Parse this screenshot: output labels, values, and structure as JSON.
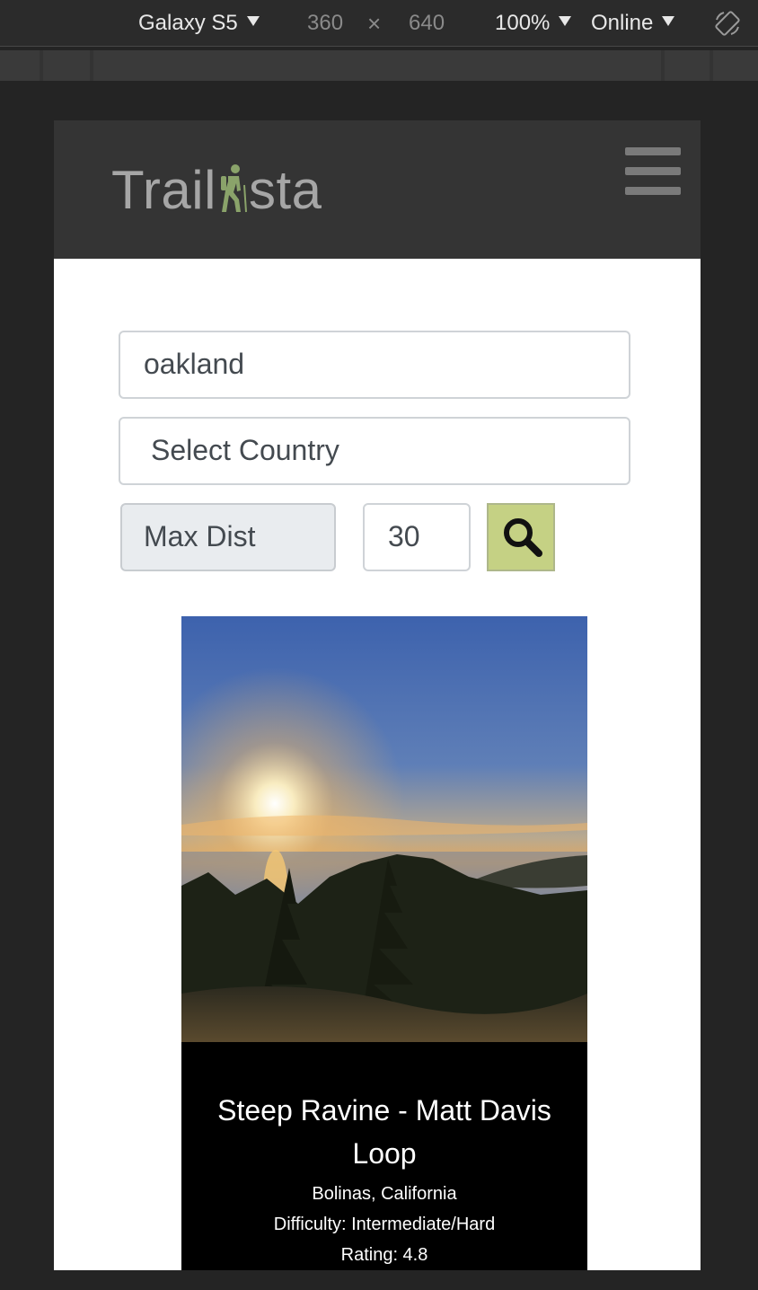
{
  "devtools": {
    "device": "Galaxy S5",
    "width": "360",
    "times": "×",
    "height": "640",
    "zoom": "100%",
    "network": "Online",
    "rotate_icon": "rotate-device-icon"
  },
  "navbar": {
    "brand_prefix": "Trail",
    "brand_icon": "hiker-icon",
    "brand_suffix": "sta",
    "menu_icon": "hamburger-menu-icon"
  },
  "search": {
    "location_value": "oakland",
    "country_placeholder": "Select Country",
    "max_dist_label": "Max Dist",
    "max_dist_value": "30",
    "button_icon": "search-icon"
  },
  "results": [
    {
      "name": "Steep Ravine - Matt Davis Loop",
      "location": "Bolinas, California",
      "difficulty": "Difficulty: Intermediate/Hard",
      "rating": "Rating: 4.8"
    }
  ],
  "colors": {
    "brand_text": "#a6a6a6",
    "brand_accent": "#8aa36a",
    "navbar_bg": "#343434",
    "search_button_bg": "#c5d184",
    "card_bg": "#000000"
  }
}
